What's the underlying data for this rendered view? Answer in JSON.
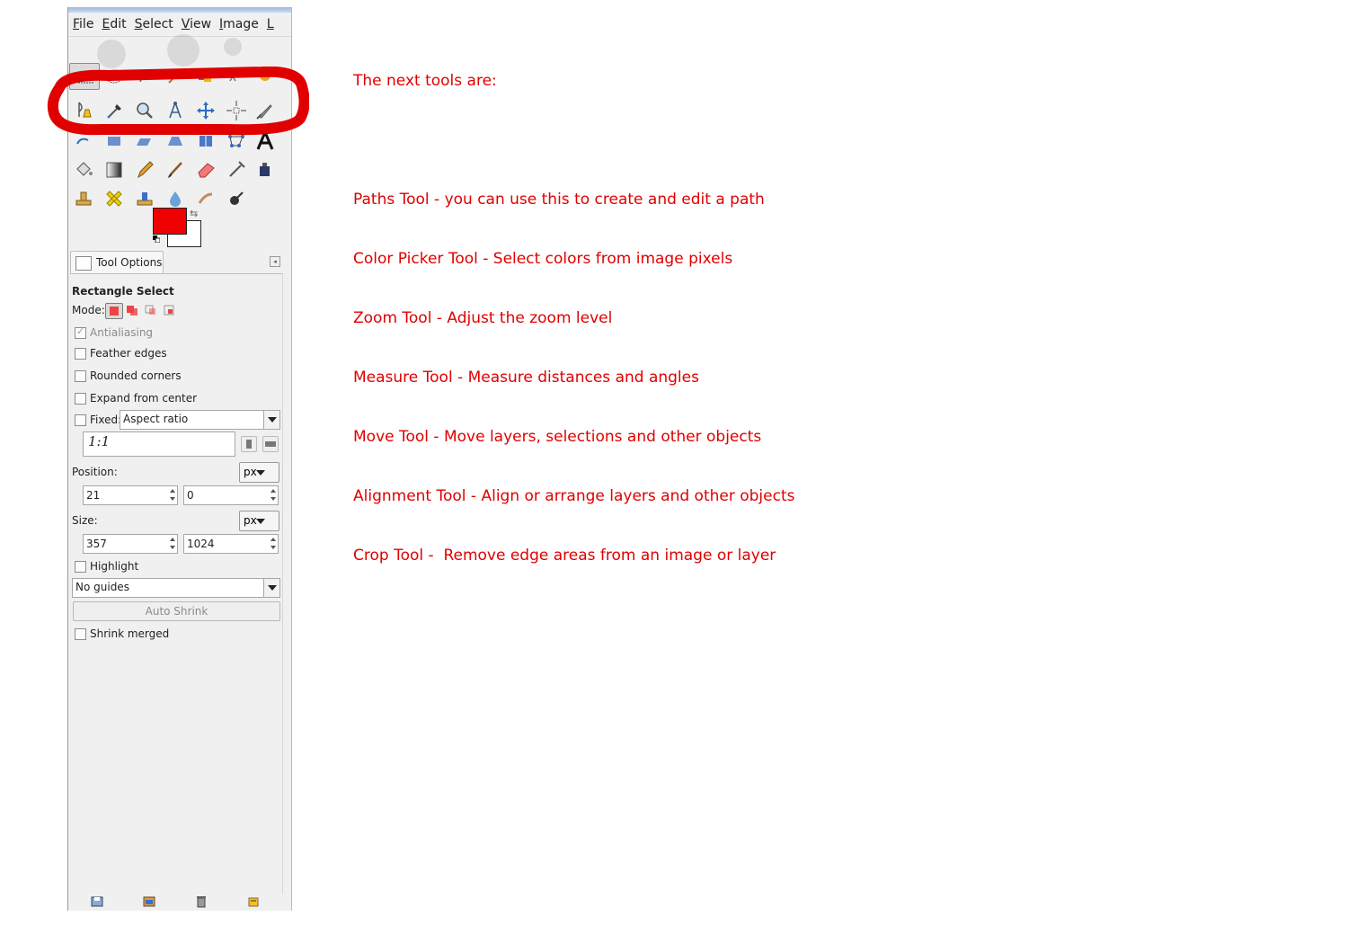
{
  "menu": {
    "items": [
      {
        "label": "File",
        "accel": "F",
        "rest": "ile"
      },
      {
        "label": "Edit",
        "accel": "E",
        "rest": "dit"
      },
      {
        "label": "Select",
        "accel": "S",
        "rest": "elect"
      },
      {
        "label": "View",
        "accel": "V",
        "rest": "iew"
      },
      {
        "label": "Image",
        "accel": "I",
        "rest": "mage"
      },
      {
        "label": "L",
        "accel": "L",
        "rest": ""
      }
    ]
  },
  "colors": {
    "foreground": "#ee0000",
    "background": "#ffffff",
    "annotation": "#e00000"
  },
  "highlighted_tools": [
    "paths-tool",
    "color-picker-tool",
    "zoom-tool",
    "measure-tool",
    "move-tool",
    "alignment-tool",
    "crop-tool"
  ],
  "tool_options": {
    "tab_label": "Tool Options",
    "tool_name": "Rectangle Select",
    "mode_label": "Mode:",
    "antialiasing_label": "Antialiasing",
    "feather_label": "Feather edges",
    "rounded_label": "Rounded corners",
    "expand_label": "Expand from center",
    "fixed_label": "Fixed:",
    "fixed_value": "Aspect ratio",
    "ratio_value": "1:1",
    "position_label": "Position:",
    "position_unit": "px",
    "position_x": "21",
    "position_y": "0",
    "size_label": "Size:",
    "size_unit": "px",
    "size_w": "357",
    "size_h": "1024",
    "highlight_label": "Highlight",
    "guides_value": "No guides",
    "auto_shrink_label": "Auto Shrink",
    "shrink_merged_label": "Shrink merged"
  },
  "notes": {
    "heading": "The next tools are:",
    "lines": [
      "Paths Tool - you can use this to create and edit a path",
      "Color Picker Tool - Select colors from image pixels",
      "Zoom Tool - Adjust the zoom level",
      "Measure Tool - Measure distances and angles",
      "Move Tool - Move layers, selections and other objects",
      "Alignment Tool - Align or arrange layers and other objects",
      "Crop Tool -  Remove edge areas from an image or layer"
    ]
  }
}
